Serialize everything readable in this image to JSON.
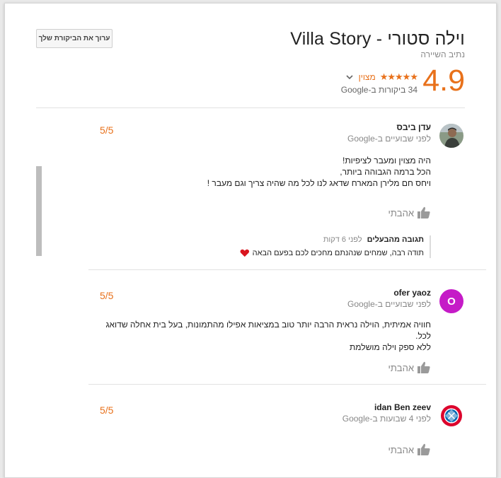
{
  "header": {
    "edit_button": "ערוך את הביקורת שלך",
    "title": "וילה סטורי - Villa Story",
    "subtitle": "נתיב השיירה",
    "score": "4.9",
    "stars": "★★★★★",
    "rating_word": "מצוין",
    "review_count": "34 ביקורות ב-Google"
  },
  "reviews": [
    {
      "name": "עדן ביבס",
      "time": "לפני שבועיים ב-Google",
      "score": "5/5",
      "text_lines": [
        "היה מצוין ומעבר לציפיות!",
        "הכל ברמה הגבוהה ביותר,",
        "ויחס חם מלירן המארח שדאג לנו לכל מה שהיה צריך וגם מעבר !"
      ],
      "like": "אהבתי",
      "owner_reply": {
        "title": "תגובה מהבעלים",
        "time": "לפני 6 דקות",
        "text": "תודה רבה, שמחים שנהנתם מחכים לכם בפעם הבאה"
      }
    },
    {
      "name": "ofer yaoz",
      "avatar_letter": "O",
      "time": "לפני שבועיים ב-Google",
      "score": "5/5",
      "text_lines": [
        "חוויה אמיתית, הוילה נראית הרבה יותר טוב במציאות אפילו מהתמונות, בעל בית אחלה שדואג לכל.",
        "ללא ספק וילה מושלמת"
      ],
      "like": "אהבתי"
    },
    {
      "name": "idan Ben zeev",
      "time": "לפני 4 שבועות ב-Google",
      "score": "5/5",
      "like": "אהבתי"
    }
  ],
  "colors": {
    "accent": "#e8711b",
    "avatar_o": "#c51bc7"
  }
}
